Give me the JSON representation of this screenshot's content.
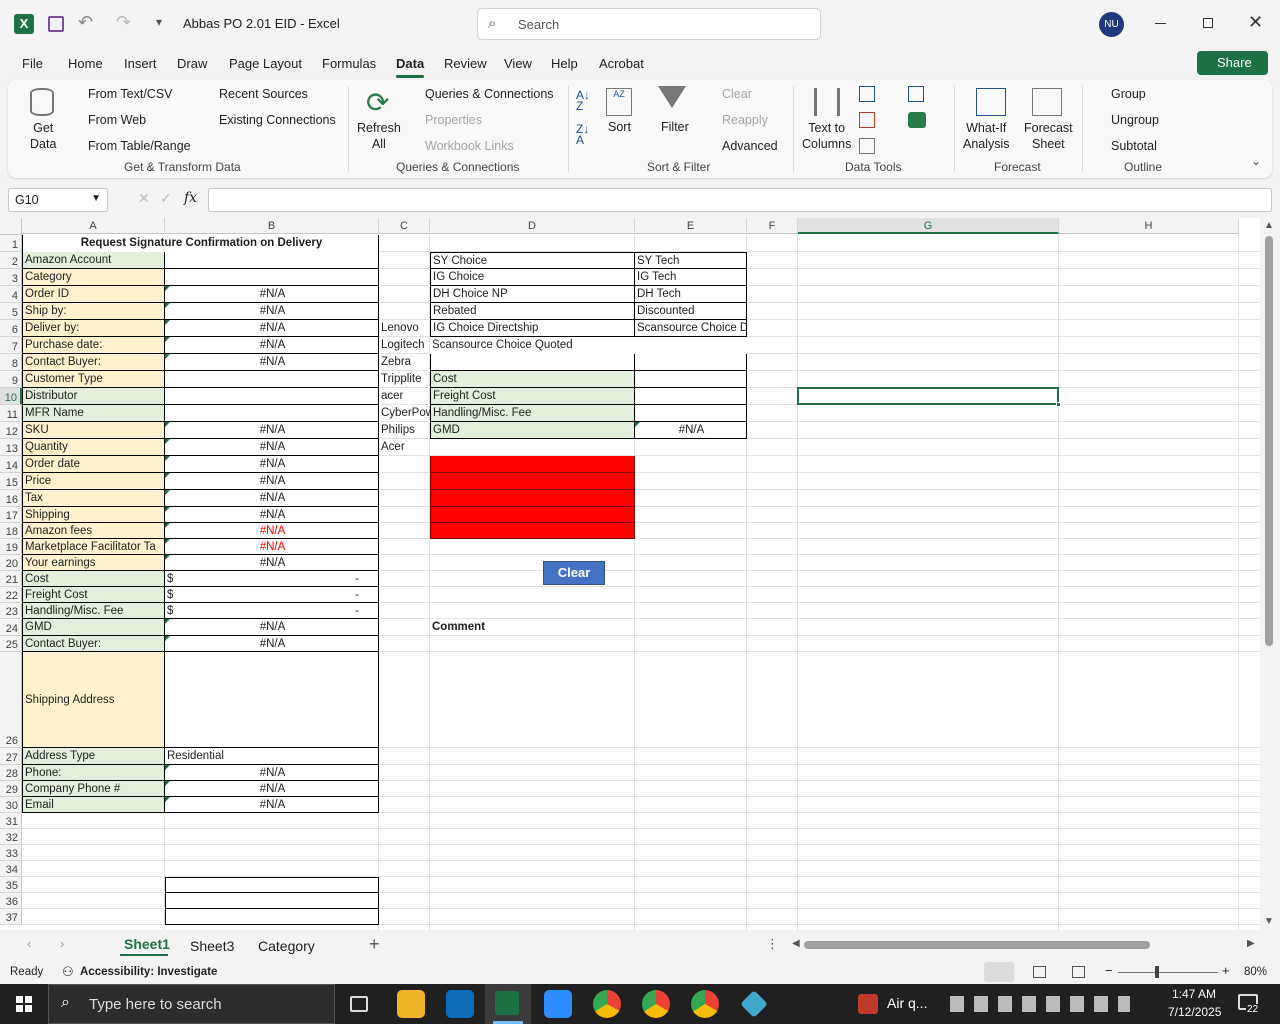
{
  "title_bar": {
    "doc_title": "Abbas PO 2.01 EID  -  Excel",
    "search_placeholder": "Search",
    "user_initials": "NU"
  },
  "menu": [
    "File",
    "Home",
    "Insert",
    "Draw",
    "Page Layout",
    "Formulas",
    "Data",
    "Review",
    "View",
    "Help",
    "Acrobat"
  ],
  "share_label": "Share",
  "ribbon": {
    "get_data": "Get\nData",
    "get_transform": [
      "From Text/CSV",
      "From Web",
      "From Table/Range",
      "Recent Sources",
      "Existing Connections"
    ],
    "refresh_all": "Refresh\nAll",
    "queries": [
      "Queries & Connections",
      "Properties",
      "Workbook Links"
    ],
    "sort": "Sort",
    "filter": "Filter",
    "clear": "Clear",
    "reapply": "Reapply",
    "advanced": "Advanced",
    "text_to_columns": "Text to\nColumns",
    "what_if": "What-If\nAnalysis",
    "forecast_sheet": "Forecast\nSheet",
    "outline": [
      "Group",
      "Ungroup",
      "Subtotal"
    ],
    "groups": [
      "Get & Transform Data",
      "Queries & Connections",
      "Sort & Filter",
      "Data Tools",
      "Forecast",
      "Outline"
    ]
  },
  "name_box": "G10",
  "fx": "fx",
  "columns": [
    "A",
    "B",
    "C",
    "D",
    "E",
    "F",
    "G",
    "H"
  ],
  "rows": [
    "1",
    "2",
    "3",
    "4",
    "5",
    "6",
    "7",
    "8",
    "9",
    "10",
    "11",
    "12",
    "13",
    "14",
    "15",
    "16",
    "17",
    "18",
    "19",
    "20",
    "21",
    "22",
    "23",
    "24",
    "25",
    "26",
    "27",
    "28",
    "29",
    "30",
    "31",
    "32",
    "33",
    "34",
    "35",
    "36",
    "37"
  ],
  "colA": [
    "Request Signature Confirmation on Delivery",
    "Amazon Account",
    "Category",
    "Order ID",
    "Ship by:",
    "Deliver by:",
    "Purchase date:",
    "Contact Buyer:",
    "Customer Type",
    "Distributor",
    "MFR Name",
    "SKU",
    "Quantity",
    "Order date",
    "Price",
    "Tax",
    "Shipping",
    "Amazon fees",
    "Marketplace Facilitator Ta",
    "Your earnings",
    "Cost",
    "Freight Cost",
    "Handling/Misc. Fee",
    "GMD",
    "Contact Buyer:",
    "Shipping Address",
    "Address Type",
    "Phone:",
    "Company Phone #",
    "Email"
  ],
  "colB": {
    "na": "#N/A",
    "dollar": "$",
    "dash": "-",
    "residential": "Residential"
  },
  "colC": [
    "Lenovo",
    "Logitech",
    "Zebra",
    "Tripplite",
    "acer",
    "CyberPow",
    "Philips",
    "Acer"
  ],
  "colD": [
    "SY Choice",
    "IG Choice",
    "DH Choice NP",
    " Rebated",
    "IG Choice Directship",
    "Scansource Choice Quoted",
    "",
    "Cost",
    "Freight Cost",
    "Handling/Misc. Fee",
    "GMD"
  ],
  "colE": [
    "SY Tech",
    "IG Tech",
    "DH Tech",
    " Discounted",
    "Scansource Choice Directship",
    "",
    "",
    "",
    "",
    "",
    "#N/A"
  ],
  "clear_button": "Clear",
  "comment_label": "Comment",
  "sheet_tabs": [
    "Sheet1",
    "Sheet3",
    "Category"
  ],
  "status": {
    "ready": "Ready",
    "accessibility": "Accessibility: Investigate",
    "zoom": "80%"
  },
  "taskbar": {
    "search_placeholder": "Type here to search",
    "weather": "Air q...",
    "time": "1:47 AM",
    "date": "7/12/2025",
    "notifications": "22"
  },
  "colors": {
    "excel_green": "#1e7145",
    "label_green": "#e2efda",
    "label_yellow": "#fff2cc",
    "red_fill": "#ff0000",
    "button_blue": "#4472c4"
  }
}
